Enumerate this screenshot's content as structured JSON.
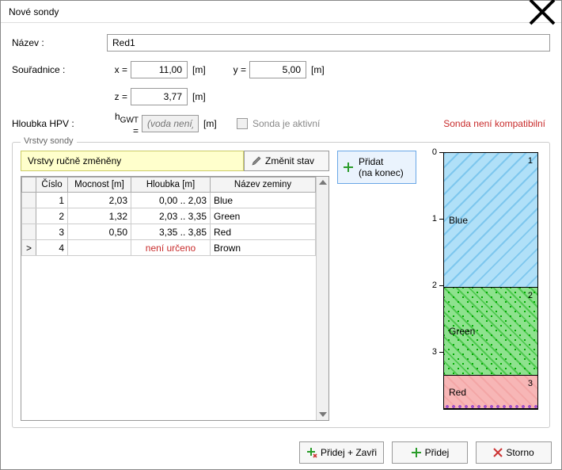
{
  "title": "Nové sondy",
  "form": {
    "name_label": "Název :",
    "name_value": "Red1",
    "coord_label": "Souřadnice :",
    "x_label": "x =",
    "x_value": "11,00",
    "y_label": "y =",
    "y_value": "5,00",
    "z_label": "z =",
    "z_value": "3,77",
    "unit_m": "[m]",
    "depth_label": "Hloubka HPV :",
    "hgwt_label_html": "h<sub>GWT</sub> =",
    "hgwt_label_plain": "hGWT =",
    "hgwt_placeholder": "(voda není)",
    "active_label": "Sonda je aktivní",
    "warning": "Sonda není kompatibilní"
  },
  "group_title": "Vrstvy sondy",
  "note": "Vrstvy ručně změněny",
  "change_state_btn": "Změnit stav",
  "add_btn_line1": "Přidat",
  "add_btn_line2": "(na konec)",
  "table": {
    "headers": [
      "Číslo",
      "Mocnost [m]",
      "Hloubka [m]",
      "Název zeminy"
    ],
    "rows": [
      {
        "mark": "",
        "num": "1",
        "mocnost": "2,03",
        "hloubka": "0,00 .. 2,03",
        "nazev": "Blue"
      },
      {
        "mark": "",
        "num": "2",
        "mocnost": "1,32",
        "hloubka": "2,03 .. 3,35",
        "nazev": "Green"
      },
      {
        "mark": "",
        "num": "3",
        "mocnost": "0,50",
        "hloubka": "3,35 .. 3,85",
        "nazev": "Red"
      },
      {
        "mark": ">",
        "num": "4",
        "mocnost": "",
        "hloubka": "není určeno",
        "nazev": "Brown",
        "red": true
      }
    ]
  },
  "ruler_ticks": [
    "0",
    "1",
    "2",
    "3"
  ],
  "strata": [
    {
      "name": "Blue",
      "index": "1",
      "top": 0.0,
      "bottom": 2.03,
      "cls": "blue"
    },
    {
      "name": "Green",
      "index": "2",
      "top": 2.03,
      "bottom": 3.35,
      "cls": "green"
    },
    {
      "name": "Red",
      "index": "3",
      "top": 3.35,
      "bottom": 3.85,
      "cls": "red"
    }
  ],
  "strata_max": 3.85,
  "footer": {
    "add_close": "Přidej + Zavři",
    "add": "Přidej",
    "cancel": "Storno"
  }
}
